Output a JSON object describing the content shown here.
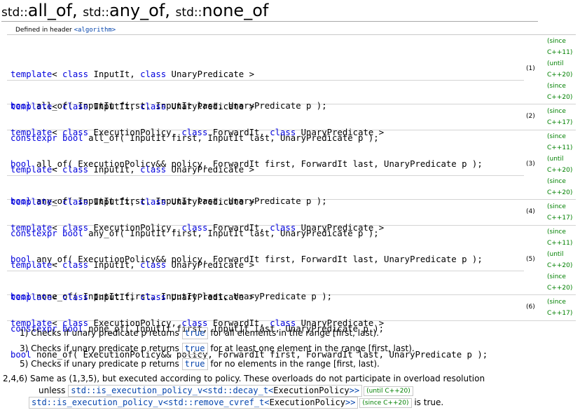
{
  "title": {
    "parts": [
      {
        "ns": "std::",
        "name": "all_of",
        "sep": ", "
      },
      {
        "ns": "std::",
        "name": "any_of",
        "sep": ", "
      },
      {
        "ns": "std::",
        "name": "none_of",
        "sep": ""
      }
    ]
  },
  "header": {
    "prefix": "Defined in header ",
    "name": "<algorithm>"
  },
  "templates": {
    "input_unary": "template< class InputIt, class UnaryPredicate >",
    "exec_forward_unary": "template< class ExecutionPolicy, class ForwardIt, class UnaryPredicate >"
  },
  "decls": {
    "all_of_1": "bool all_of( InputIt first, InputIt last, UnaryPredicate p );",
    "all_of_1c": "constexpr bool all_of( InputIt first, InputIt last, UnaryPredicate p );",
    "all_of_2": "bool all_of( ExecutionPolicy&& policy, ForwardIt first, ForwardIt last, UnaryPredicate p );",
    "any_of_3": "bool any_of( InputIt first, InputIt last, UnaryPredicate p );",
    "any_of_3c": "constexpr bool any_of( InputIt first, InputIt last, UnaryPredicate p );",
    "any_of_4": "bool any_of( ExecutionPolicy&& policy, ForwardIt first, ForwardIt last, UnaryPredicate p );",
    "none_of_5": "bool none_of( InputIt first, InputIt last, UnaryPredicate p );",
    "none_of_5c": "constexpr bool none_of( InputIt first, InputIt last, UnaryPredicate p );",
    "none_of_6": "bool none_of( ExecutionPolicy&& policy, ForwardIt first, ForwardIt last, UnaryPredicate p );"
  },
  "labels": {
    "n1": "(1)",
    "n2": "(2)",
    "n3": "(3)",
    "n4": "(4)",
    "n5": "(5)",
    "n6": "(6)"
  },
  "versions": {
    "since": "(since",
    "until": "(until",
    "cpp11": "C++11)",
    "cpp17": "C++17)",
    "cpp20": "C++20)"
  },
  "descriptions": {
    "d1": {
      "num": "1)",
      "pre": "Checks if unary predicate p returns",
      "kw": "true",
      "post": "for all elements in the range [first, last)."
    },
    "d3": {
      "num": "3)",
      "pre": "Checks if unary predicate p returns",
      "kw": "true",
      "post": "for at least one element in the range [first, last)."
    },
    "d5": {
      "num": "5)",
      "pre": "Checks if unary predicate p returns",
      "kw": "true",
      "post": "for no elements in the range [first, last)."
    },
    "d246": {
      "num": "2,4,6)",
      "text": "Same as (1,3,5), but executed according to policy. These overloads do not participate in overload resolution",
      "unless": "unless",
      "cond1_trait": "std::is_execution_policy_v",
      "cond1_inner": "std::decay_t",
      "cond1_arg": "ExecutionPolicy",
      "cond1_tag": "(until C++20)",
      "cond2_trait": "std::is_execution_policy_v",
      "cond2_inner": "std::remove_cvref_t",
      "cond2_arg": "ExecutionPolicy",
      "cond2_tag": "(since C++20)",
      "end": "is true."
    }
  }
}
